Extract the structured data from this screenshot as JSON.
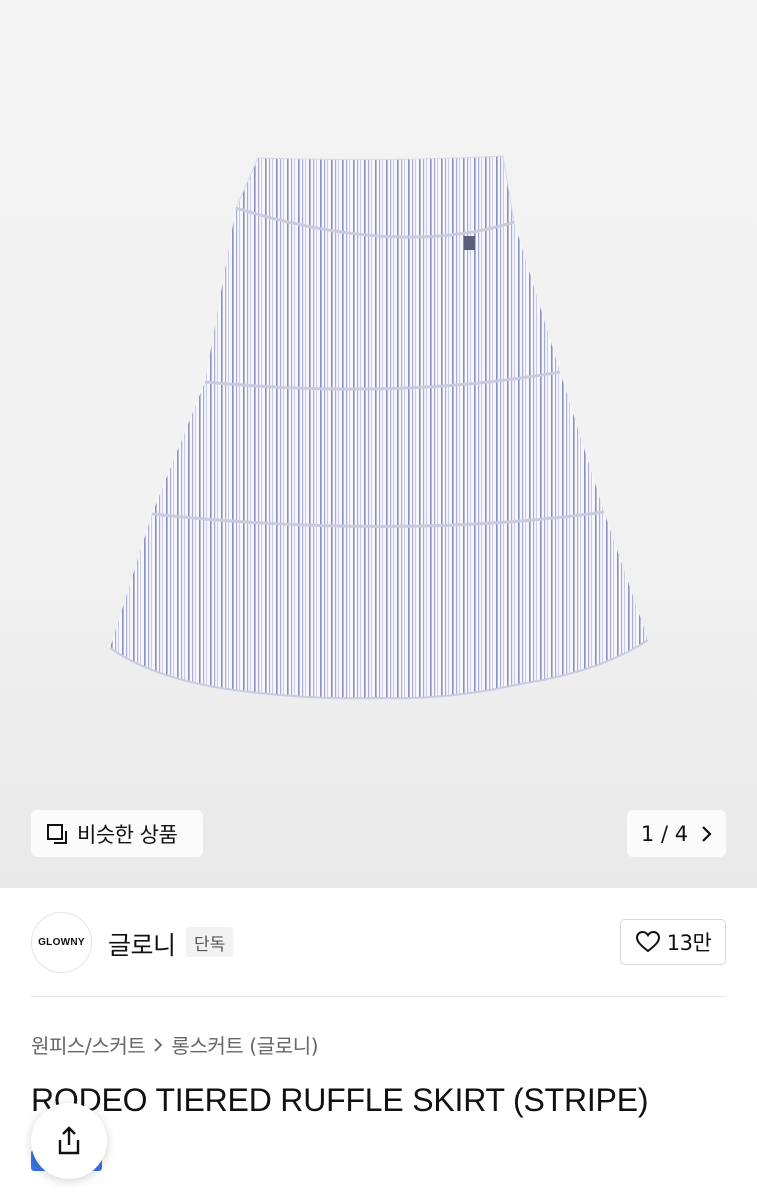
{
  "gallery": {
    "similar_label": "비슷한 상품",
    "page_indicator": "1 / 4",
    "image_alt": "RODEO TIERED RUFFLE SKIRT (STRIPE)"
  },
  "brand": {
    "logo_text": "GLOWNY",
    "name": "글로니",
    "badge": "단독",
    "likes": "13만"
  },
  "breadcrumb": {
    "category": "원피스/스커트",
    "subcategory": "롱스커트 (글로니)"
  },
  "product": {
    "title": "RODEO TIERED RUFFLE SKIRT (STRIPE)"
  },
  "icons": {
    "similar": "copy-squares-icon",
    "next": "chevron-right-icon",
    "like": "heart-outline-icon",
    "share": "share-icon"
  },
  "colors": {
    "accent_blue": "#3a74e8",
    "stripe": "#8a8fc2"
  }
}
